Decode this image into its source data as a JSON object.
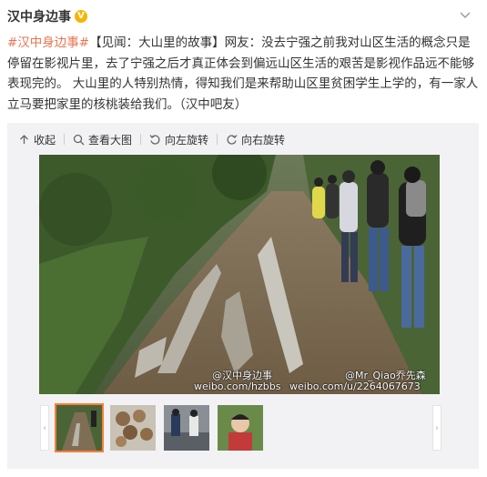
{
  "post": {
    "author": "汉中身边事",
    "verified_badge": "V",
    "topic": "#汉中身边事#",
    "body": "【见闻：大山里的故事】网友：没去宁强之前我对山区生活的概念只是停留在影视片里，去了宁强之后才真正体会到偏远山区生活的艰苦是影视作品远不能够表现完的。 大山里的人特别热情，得知我们是来帮助山区里贫困学生上学的，有一家人立马要把家里的核桃装给我们。（汉中吧友）"
  },
  "toolbar": {
    "collapse": "收起",
    "view_large": "查看大图",
    "rotate_left": "向左旋转",
    "rotate_right": "向右旋转"
  },
  "image": {
    "watermark_left_name": "@汉中身边事",
    "watermark_left_url": "weibo.com/hzbbs",
    "watermark_right_name": "@Mr_Qiao乔先森",
    "watermark_right_url": "weibo.com/u/2264067673"
  },
  "thumbnails": {
    "count": 4,
    "selected_index": 0,
    "prev_arrow": "‹",
    "next_arrow": "›"
  },
  "colors": {
    "topic_link": "#eb7350",
    "badge": "#f7b500",
    "thumb_selected": "#fa7d3c",
    "media_bg": "#f2f2f5"
  }
}
